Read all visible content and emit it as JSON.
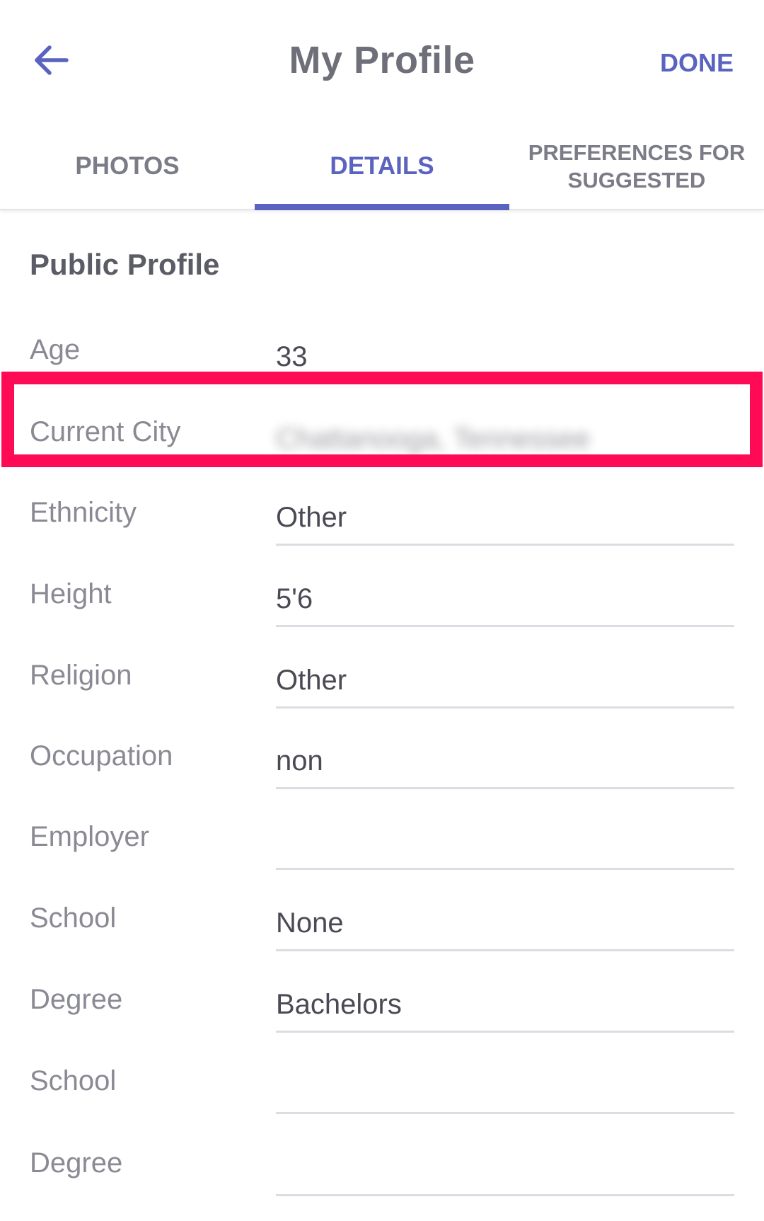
{
  "header": {
    "title": "My Profile",
    "done_label": "DONE",
    "back_icon": "arrow-left-icon"
  },
  "tabs": [
    {
      "label": "PHOTOS",
      "active": false
    },
    {
      "label": "DETAILS",
      "active": true
    },
    {
      "label": "PREFERENCES FOR SUGGESTED",
      "active": false
    }
  ],
  "section": {
    "title": "Public Profile"
  },
  "fields": [
    {
      "label": "Age",
      "value": "33"
    },
    {
      "label": "Current City",
      "value": "Chattanooga, Tennessee"
    },
    {
      "label": "Ethnicity",
      "value": "Other"
    },
    {
      "label": "Height",
      "value": "5'6"
    },
    {
      "label": "Religion",
      "value": "Other"
    },
    {
      "label": "Occupation",
      "value": "non"
    },
    {
      "label": "Employer",
      "value": ""
    },
    {
      "label": "School",
      "value": "None"
    },
    {
      "label": "Degree",
      "value": "Bachelors"
    },
    {
      "label": "School",
      "value": ""
    },
    {
      "label": "Degree",
      "value": ""
    }
  ],
  "colors": {
    "accent": "#5a63c0",
    "highlight": "#ff0a55",
    "label": "#8a8a94",
    "value": "#4a4a54"
  }
}
